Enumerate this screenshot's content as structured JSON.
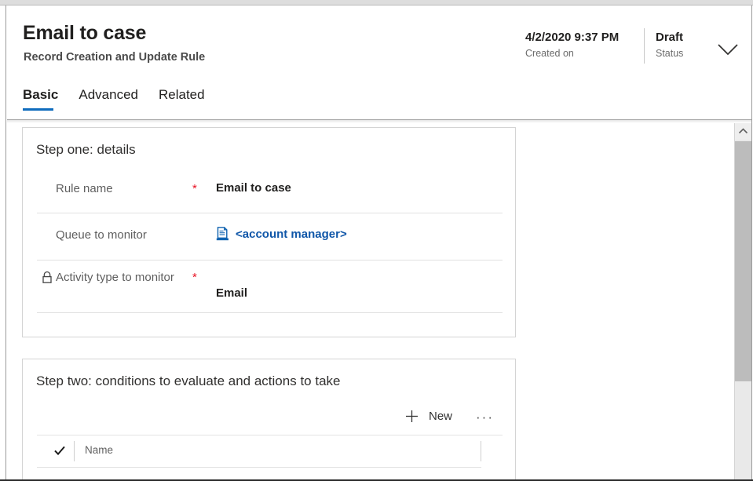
{
  "window": {
    "scrollbar": {
      "up_arrow": "chevron-up-icon",
      "thumb": "scroll-thumb"
    }
  },
  "header": {
    "title": "Email to case",
    "subtitle": "Record Creation and Update Rule",
    "created": {
      "value": "4/2/2020 9:37 PM",
      "label": "Created on"
    },
    "status": {
      "value": "Draft",
      "label": "Status"
    },
    "expand_icon": "chevron-down-icon",
    "tabs": [
      {
        "label": "Basic",
        "active": true
      },
      {
        "label": "Advanced",
        "active": false
      },
      {
        "label": "Related",
        "active": false
      }
    ]
  },
  "step_one": {
    "title": "Step one: details",
    "rows": [
      {
        "label": "Rule name",
        "required": "*",
        "value": "Email to case",
        "locked": false,
        "type": "text"
      },
      {
        "label": "Queue to monitor",
        "required": "",
        "value": "<account manager>",
        "locked": false,
        "type": "lookup",
        "icon": "queue-icon"
      },
      {
        "label": "Activity type to monitor",
        "required": "*",
        "value": "Email",
        "locked": true,
        "lock_icon": "lock-icon",
        "type": "text"
      }
    ]
  },
  "step_two": {
    "title": "Step two: conditions to evaluate and actions to take",
    "toolbar": {
      "new_label": "New",
      "new_icon": "plus-icon",
      "more_label": "···",
      "more_icon": "ellipsis-icon"
    },
    "grid": {
      "select_all_icon": "checkmark-icon",
      "columns": [
        "Name"
      ],
      "rows": []
    }
  },
  "colors": {
    "accent": "#0f6cbd",
    "link": "#0f56a8",
    "required": "#e81123",
    "text": "#201f1e",
    "muted": "#5f5f5f",
    "border": "#d4d4d4"
  }
}
